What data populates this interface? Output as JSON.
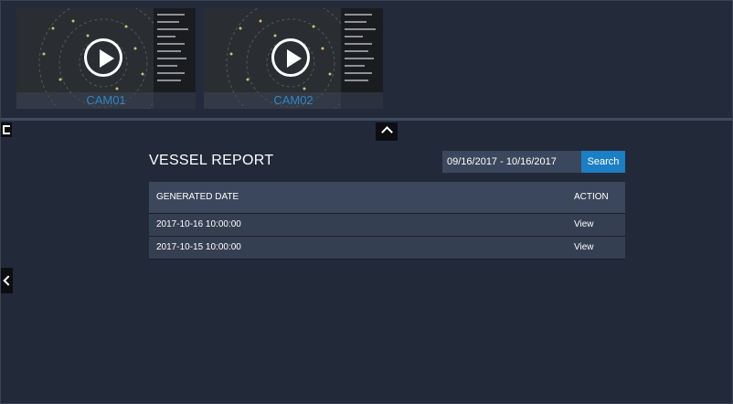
{
  "cameras": [
    {
      "label": "CAM01"
    },
    {
      "label": "CAM02"
    }
  ],
  "report": {
    "title": "VESSEL REPORT",
    "date_range": "09/16/2017 - 10/16/2017",
    "search_label": "Search",
    "columns": [
      "GENERATED DATE",
      "ACTION"
    ],
    "rows": [
      {
        "date": "2017-10-16 10:00:00",
        "action": "View"
      },
      {
        "date": "2017-10-15 10:00:00",
        "action": "View"
      }
    ]
  },
  "colors": {
    "background": "#222a39",
    "accent": "#1b7fc3",
    "table_header": "#3b475c",
    "table_row": "#353f52"
  },
  "icons": [
    "play-icon",
    "expand-icon",
    "chevron-up-icon",
    "chevron-left-icon"
  ]
}
